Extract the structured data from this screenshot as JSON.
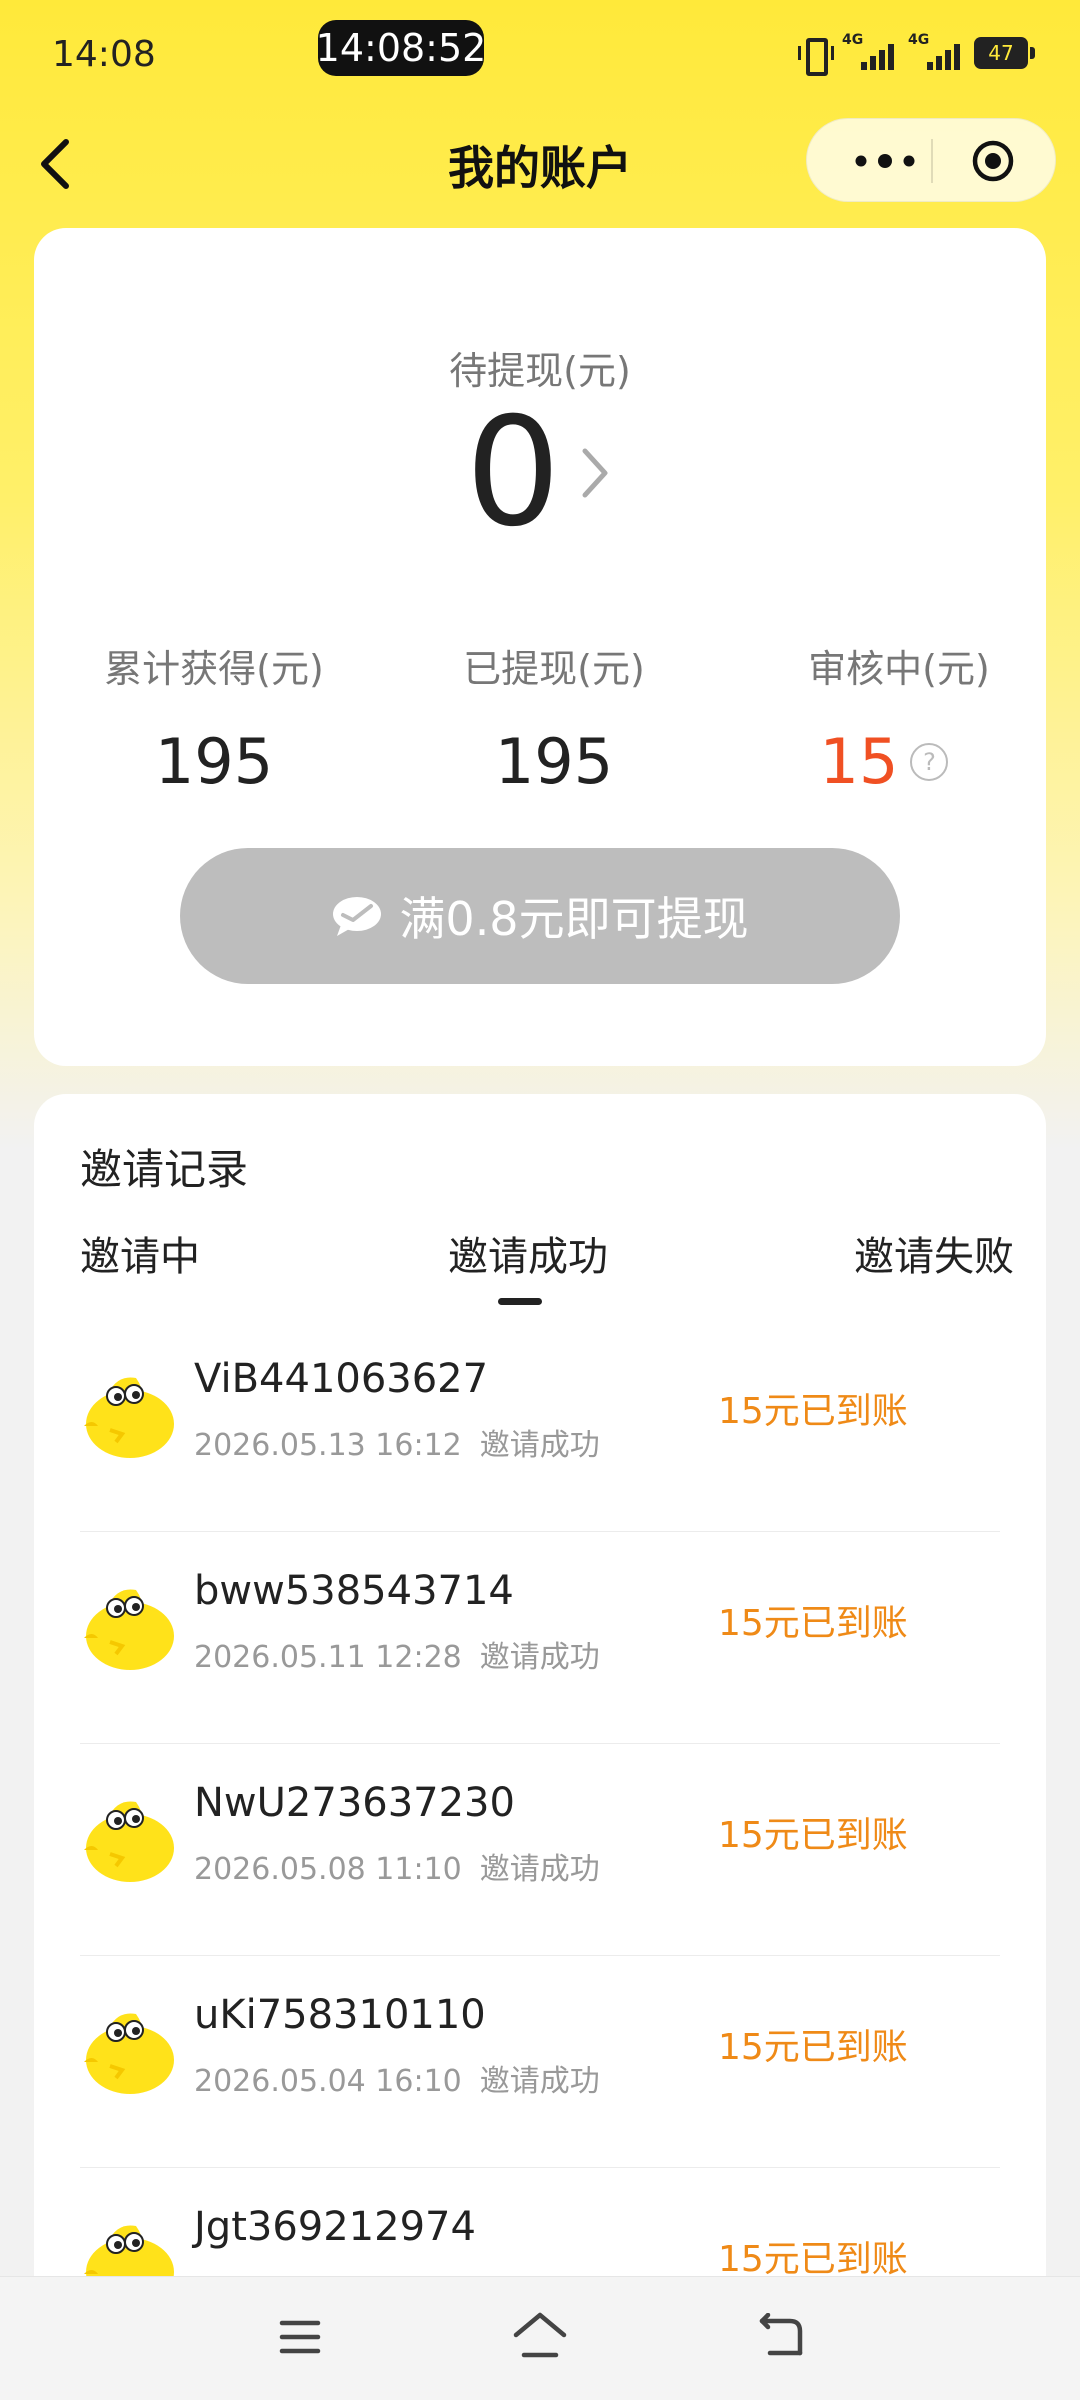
{
  "status_bar": {
    "time": "14:08",
    "clock_pill": "14:08:52",
    "network_1": "4G",
    "network_2": "4G",
    "battery": "47"
  },
  "header": {
    "title": "我的账户"
  },
  "account": {
    "pending_label": "待提现(元)",
    "pending_value": "0",
    "stats": {
      "total_label": "累计获得(元)",
      "total_value": "195",
      "withdrawn_label": "已提现(元)",
      "withdrawn_value": "195",
      "review_label": "审核中(元)",
      "review_value": "15"
    },
    "withdraw_button_label": "满0.8元即可提现",
    "review_color": "#f05023"
  },
  "records": {
    "title": "邀请记录",
    "tabs": [
      "邀请中",
      "邀请成功",
      "邀请失败"
    ],
    "active_tab": "邀请成功",
    "items": [
      {
        "name": "ViB441063627",
        "datetime": "2026.05.13 16:12",
        "status": "邀请成功",
        "reward": "15元已到账"
      },
      {
        "name": "bww538543714",
        "datetime": "2026.05.11 12:28",
        "status": "邀请成功",
        "reward": "15元已到账"
      },
      {
        "name": "NwU273637230",
        "datetime": "2026.05.08 11:10",
        "status": "邀请成功",
        "reward": "15元已到账"
      },
      {
        "name": "uKi758310110",
        "datetime": "2026.05.04 16:10",
        "status": "邀请成功",
        "reward": "15元已到账"
      },
      {
        "name": "Jgt369212974",
        "datetime": "",
        "status": "",
        "reward": "15元已到账"
      }
    ],
    "reward_color": "#ef8a17"
  },
  "icons": {
    "back": "chevron-left-icon",
    "more": "more-dots-icon",
    "mini_program": "target-icon",
    "chevron": "chevron-right-icon",
    "help": "question-circle-icon",
    "wechat_pay": "wechat-pay-icon",
    "avatar": "chick-avatar",
    "nav_menu": "menu-icon",
    "nav_home": "home-icon",
    "nav_back": "back-icon"
  },
  "help_glyph": "?"
}
